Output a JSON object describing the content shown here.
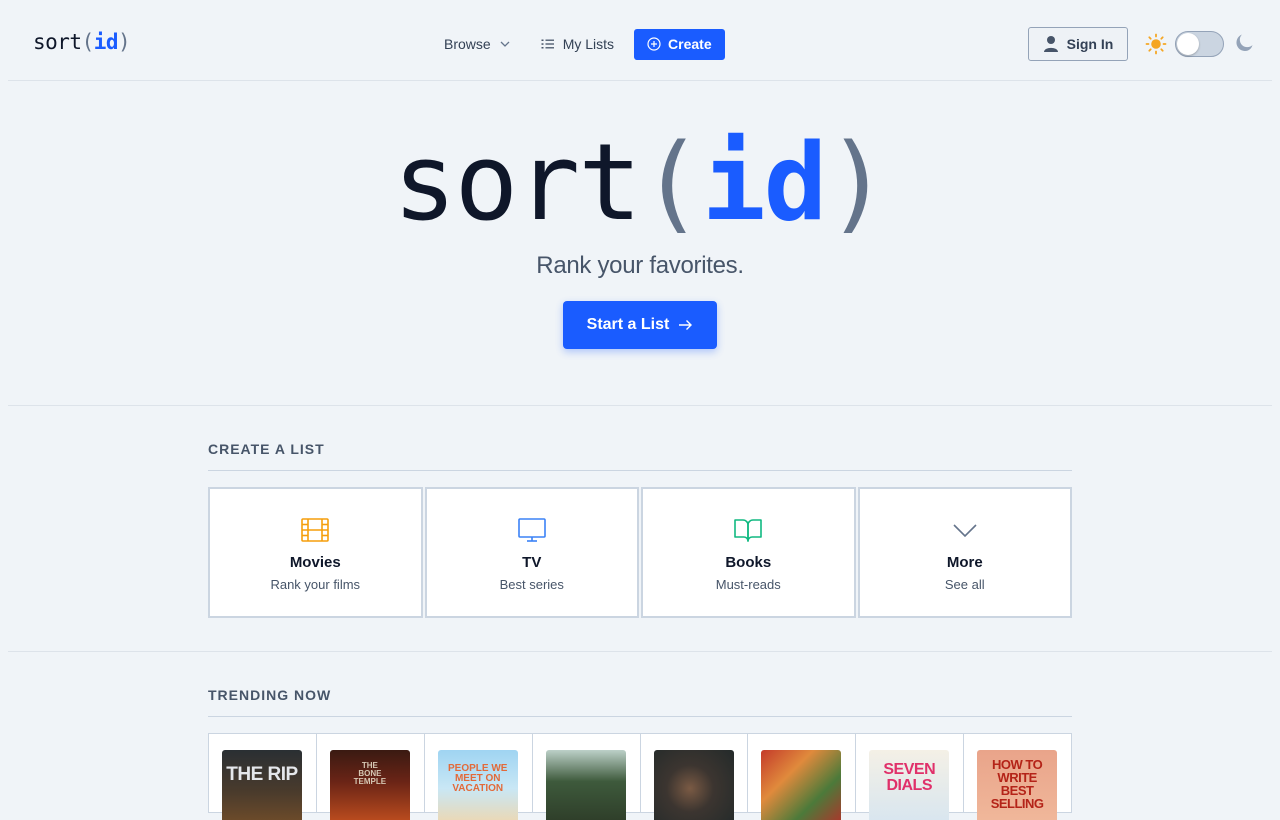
{
  "app": {
    "logo_main": "sort",
    "logo_open": "(",
    "logo_id": "id",
    "logo_close": ")"
  },
  "nav": {
    "browse": "Browse",
    "my_lists": "My Lists",
    "create": "Create",
    "sign_in": "Sign In"
  },
  "theme": {
    "light_icon": "sun-icon",
    "dark_icon": "moon-icon",
    "dark_mode": false
  },
  "hero": {
    "title_main": "sort",
    "title_open": "(",
    "title_id": "id",
    "title_close": ")",
    "tagline": "Rank your favorites.",
    "cta": "Start a List"
  },
  "create_section": {
    "title": "CREATE A LIST",
    "cards": [
      {
        "label": "Movies",
        "sub": "Rank your films",
        "icon": "film-icon",
        "color": "#f59e0b"
      },
      {
        "label": "TV",
        "sub": "Best series",
        "icon": "monitor-icon",
        "color": "#3b82f6"
      },
      {
        "label": "Books",
        "sub": "Must-reads",
        "icon": "book-open-icon",
        "color": "#10b981"
      },
      {
        "label": "More",
        "sub": "See all",
        "icon": "chevron-down-icon",
        "color": "#64748b"
      }
    ]
  },
  "trending_section": {
    "title": "TRENDING NOW",
    "items": [
      {
        "poster_text": "THE RIP"
      },
      {
        "poster_text": "THE BONE TEMPLE"
      },
      {
        "poster_text": "PEOPLE WE MEET ON VACATION"
      },
      {
        "poster_text": ""
      },
      {
        "poster_text": ""
      },
      {
        "poster_text": ""
      },
      {
        "poster_text": "SEVEN DIALS"
      },
      {
        "poster_text": "HOW TO WRITE BEST SELLING"
      }
    ]
  },
  "colors": {
    "accent": "#1a5cff",
    "background": "#f0f4f8",
    "sun": "#f5a623"
  }
}
